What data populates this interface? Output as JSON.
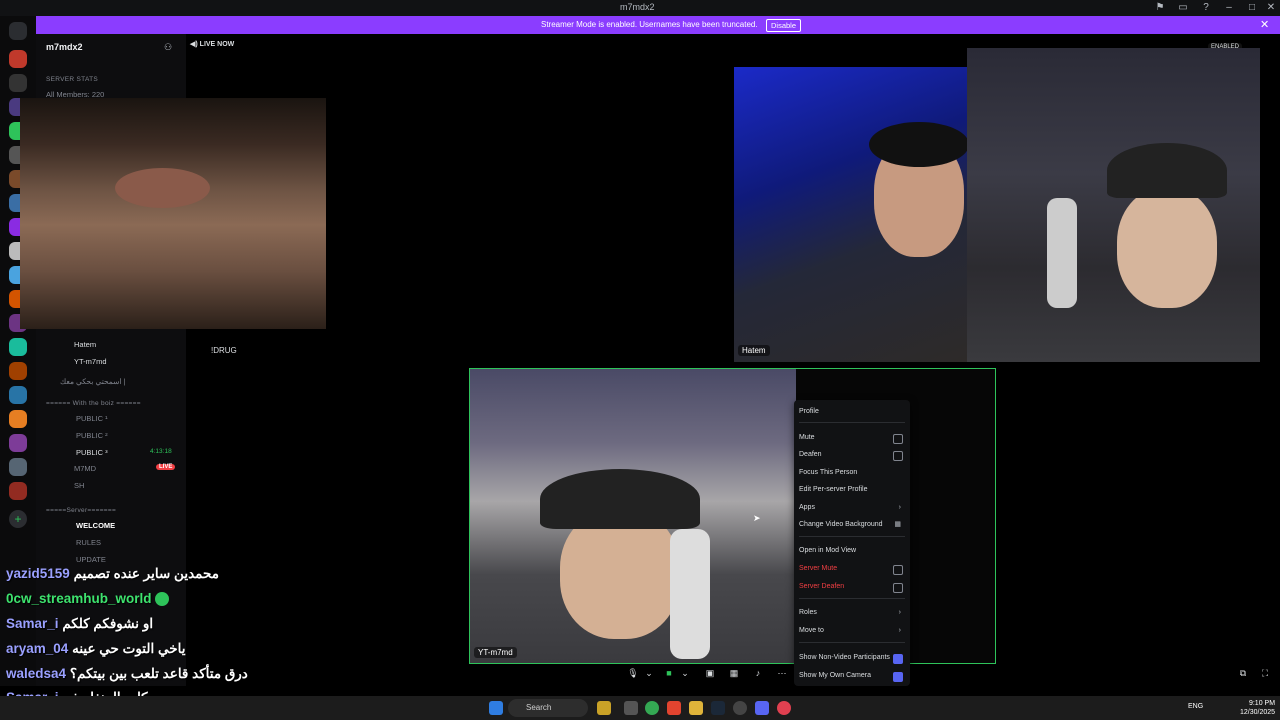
{
  "window": {
    "title": "m7mdx2"
  },
  "banner": {
    "message": "Streamer Mode is enabled. Usernames have been truncated.",
    "disable_label": "Disable"
  },
  "sidebar": {
    "server_name": "m7mdx2",
    "server_stats": "SERVER STATS",
    "all_members": "All Members: 220",
    "voice_users": [
      "Hatem",
      "YT-m7md"
    ],
    "voice_channel_arabic": "اسمحتي بحكي معك |",
    "category_boiz": "====== With the boiz ======",
    "public_channels": [
      "PUBLIC ¹",
      "PUBLIC ²",
      "PUBLIC ³"
    ],
    "public3_timer": "4:13:18",
    "public3_users": [
      "M7MD",
      "SH"
    ],
    "live_badge": "LIVE",
    "category_server": "=====Server=======",
    "text_channels": [
      "WELCOME",
      "RULES",
      "UPDATE"
    ]
  },
  "voice_header": {
    "live_now": "LIVE NOW"
  },
  "stream_label_drug": "!DRUG",
  "enabled_badge": "ENABLED",
  "tiles": {
    "hatem": "Hatem",
    "main": "YT-m7md"
  },
  "context_menu": {
    "profile": "Profile",
    "mute": "Mute",
    "deafen": "Deafen",
    "focus": "Focus This Person",
    "edit_profile": "Edit Per-server Profile",
    "apps": "Apps",
    "change_bg": "Change Video Background",
    "open_mod": "Open in Mod View",
    "server_mute": "Server Mute",
    "server_deafen": "Server Deafen",
    "roles": "Roles",
    "move_to": "Move to",
    "show_non_video": "Show Non-Video Participants",
    "show_own_camera": "Show My Own Camera"
  },
  "chat": [
    {
      "user": "yazid5159",
      "msg": "محمدين ساير عنده تصميم"
    },
    {
      "user": "0cw_streamhub_world",
      "msg": ""
    },
    {
      "user": "Samar_i",
      "msg": "او نشوفكم كلكم"
    },
    {
      "user": "aryam_04",
      "msg": "ياخي التوت حي عينه"
    },
    {
      "user": "waledsa4",
      "msg": "درق متأكد قاعد تلعب بين بيتكم؟"
    },
    {
      "user": "Samar_i",
      "msg": "حركات المنغله ذي"
    }
  ],
  "taskbar": {
    "search": "Search",
    "lang": "ENG",
    "time": "9:10 PM",
    "date": "12/30/2025"
  },
  "colors": {
    "accent": "#5865f2",
    "banner": "#8b3dff",
    "live": "#f23f43",
    "speaking": "#2ec35a"
  }
}
